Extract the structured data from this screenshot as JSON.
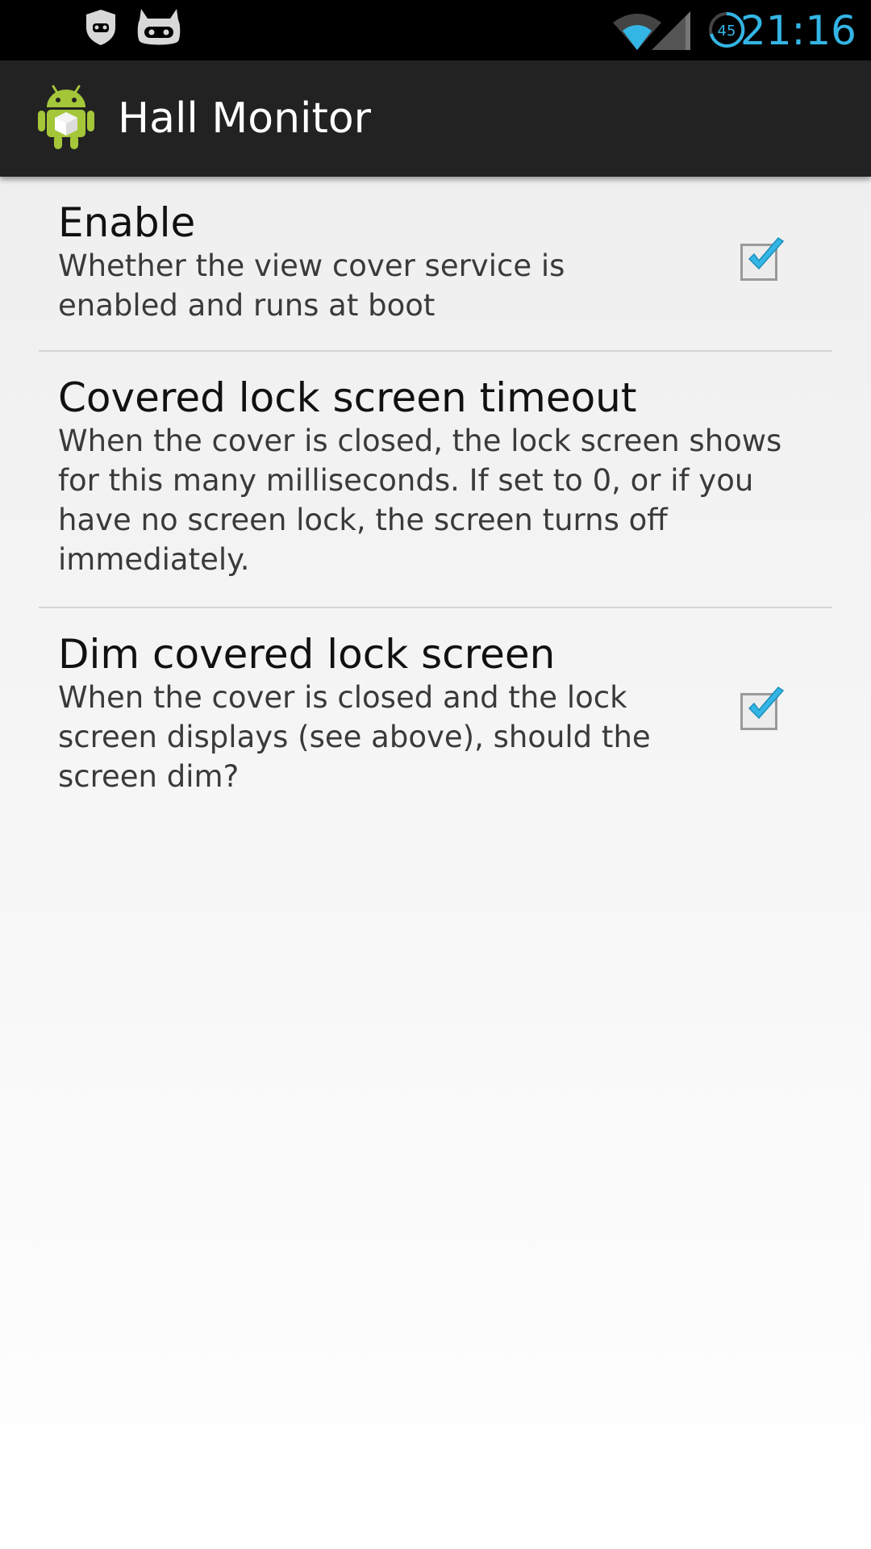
{
  "status_bar": {
    "icons": [
      "shield-icon",
      "cyanogen-mascot-icon",
      "wifi-signal-icon",
      "battery-icon"
    ],
    "battery_level": "45",
    "time": "21:16",
    "accent_color": "#33b5e5"
  },
  "action_bar": {
    "icon": "android-app-icon",
    "title": "Hall Monitor"
  },
  "preferences": [
    {
      "title": "Enable",
      "summary": "Whether the view cover service is enabled and runs at boot",
      "checked": true
    },
    {
      "title": "Covered lock screen timeout",
      "summary": "When the cover is closed, the lock screen shows for this many milliseconds. If set to 0, or if you have no screen lock, the screen turns off immediately."
    },
    {
      "title": "Dim covered lock screen",
      "summary": "When the cover is closed and the lock screen displays (see above), should the screen dim?",
      "checked": true
    }
  ],
  "colors": {
    "check_blue": "#33b5e5",
    "action_bar": "#222222"
  }
}
